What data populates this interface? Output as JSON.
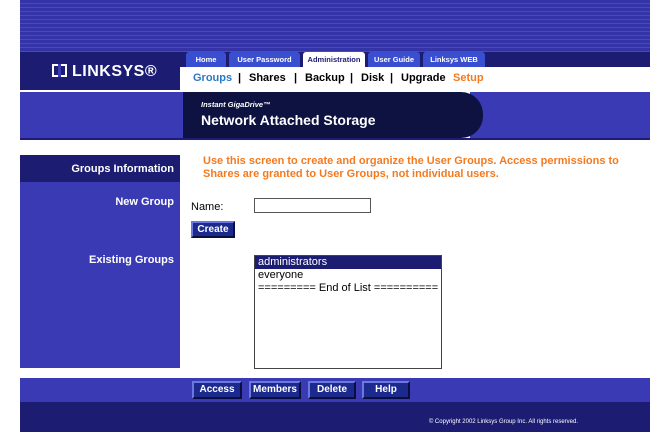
{
  "brand": {
    "logo_text": "LINKSYS®"
  },
  "tabs": [
    {
      "label": "Home"
    },
    {
      "label": "User Password"
    },
    {
      "label": "Administration"
    },
    {
      "label": "User Guide"
    },
    {
      "label": "Linksys WEB"
    }
  ],
  "subnav": {
    "groups": "Groups",
    "shares": "Shares",
    "backup": "Backup",
    "disk": "Disk",
    "upgrade": "Upgrade",
    "setup": "Setup",
    "separator": "|"
  },
  "banner": {
    "small": "Instant GigaDrive™",
    "big": "Network Attached Storage"
  },
  "sidebar": {
    "groups_information": "Groups Information",
    "new_group": "New Group",
    "existing_groups": "Existing Groups"
  },
  "main": {
    "instructions": "Use this screen to create and organize the User Groups. Access permissions to Shares are granted to User Groups, not individual users.",
    "name_label": "Name:",
    "name_value": "",
    "create_label": "Create",
    "groups": [
      "administrators",
      "everyone",
      "========= End of List =========="
    ]
  },
  "actions": {
    "access": "Access",
    "members": "Members",
    "delete": "Delete",
    "help": "Help"
  },
  "footer": {
    "copyright": "© Copyright 2002 Linksys Group Inc. All rights reserved."
  },
  "colors": {
    "stripe_blue": "#3434a8",
    "dark_blue": "#1c1c72",
    "accent_orange": "#f47a20",
    "active_link": "#2a78c6"
  }
}
